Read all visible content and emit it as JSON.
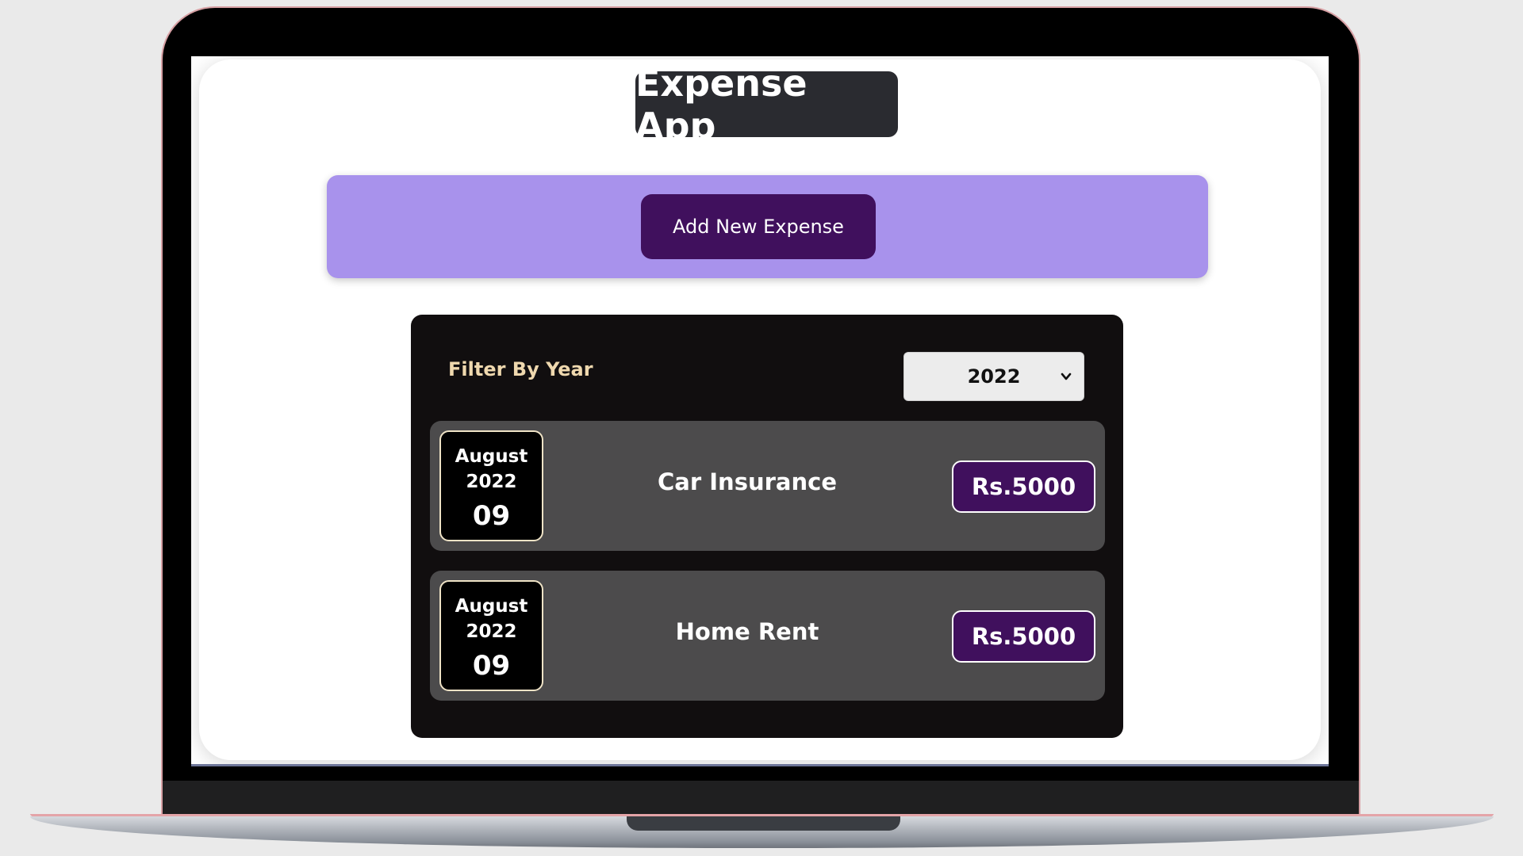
{
  "app": {
    "title": "Expense App"
  },
  "new_expense": {
    "button_label": "Add New Expense"
  },
  "filter": {
    "label": "Filter By Year",
    "selected_year": "2022"
  },
  "expenses": [
    {
      "month": "August",
      "year": "2022",
      "day": "09",
      "title": "Car Insurance",
      "amount": "Rs.5000"
    },
    {
      "month": "August",
      "year": "2022",
      "day": "09",
      "title": "Home Rent",
      "amount": "Rs.5000"
    }
  ],
  "colors": {
    "accent": "#40105d",
    "panel": "#a892ec",
    "list_bg": "#110e0f",
    "item_bg": "#4c4b4c",
    "filter_label": "#efd8ae"
  }
}
